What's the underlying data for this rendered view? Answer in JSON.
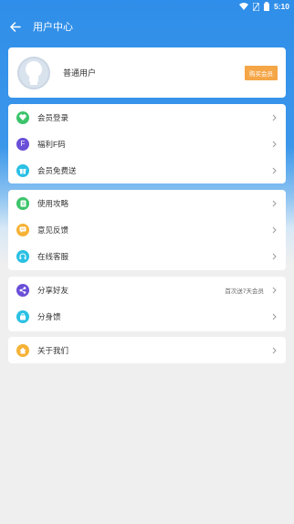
{
  "status_bar": {
    "time": "5:10"
  },
  "app_bar": {
    "title": "用户中心"
  },
  "profile": {
    "user_name": "普通用户",
    "vip_button": "购买会员"
  },
  "groups": [
    [
      {
        "label": "会员登录",
        "icon": "heart-icon",
        "color": "#3cc46b"
      },
      {
        "label": "福利F码",
        "icon": "letter-f-icon",
        "color": "#6a4fd8",
        "glyph": "F"
      },
      {
        "label": "会员免费送",
        "icon": "gift-icon",
        "color": "#2bc0e4"
      }
    ],
    [
      {
        "label": "使用攻略",
        "icon": "guide-book-icon",
        "color": "#3cc46b"
      },
      {
        "label": "意见反馈",
        "icon": "feedback-icon",
        "color": "#f5b236"
      },
      {
        "label": "在线客服",
        "icon": "headset-icon",
        "color": "#2bc0e4"
      }
    ],
    [
      {
        "label": "分享好友",
        "icon": "share-icon",
        "color": "#6a4fd8",
        "hint": "首次送7天会员"
      },
      {
        "label": "分身馈",
        "icon": "bag-icon",
        "color": "#2bc0e4"
      }
    ],
    [
      {
        "label": "关于我们",
        "icon": "home-icon",
        "color": "#f5b236"
      }
    ]
  ]
}
